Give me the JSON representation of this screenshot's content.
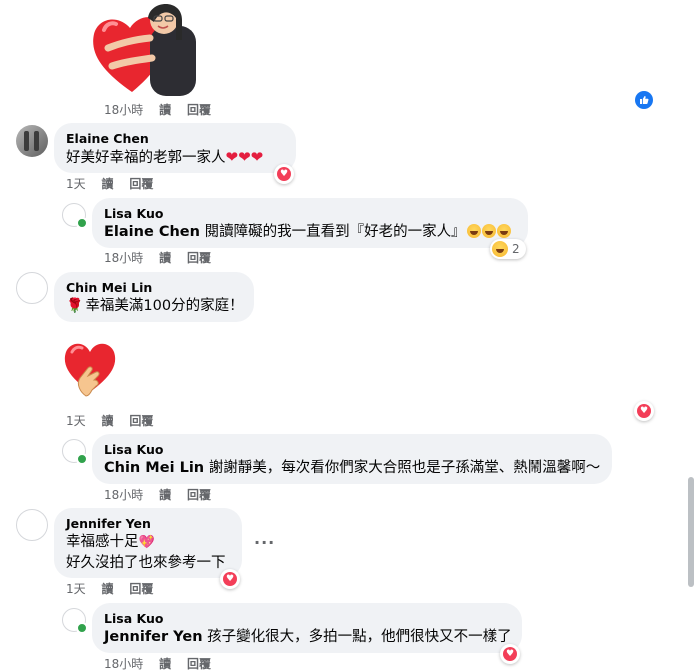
{
  "actions": {
    "read": "讀",
    "reply": "回覆"
  },
  "comments": [
    {
      "name": "",
      "time": "18小時"
    },
    {
      "name": "Elaine Chen",
      "text": "好美好幸福的老郭一家人",
      "time": "1天"
    },
    {
      "name": "Lisa Kuo",
      "tag": "Elaine Chen",
      "text": " 閱讀障礙的我一直看到『好老的一家人』",
      "time": "18小時",
      "reaction_count": "2"
    },
    {
      "name": "Chin Mei Lin",
      "text": "幸福美滿100分的家庭！",
      "time": "1天"
    },
    {
      "name": "Lisa Kuo",
      "tag": "Chin Mei Lin",
      "text": " 謝謝靜美，每次看你們家大合照也是子孫滿堂、熱鬧溫馨啊～",
      "time": "18小時"
    },
    {
      "name": "Jennifer Yen",
      "line1": "幸福感十足",
      "line2": "好久沒拍了也來參考一下",
      "time": "1天"
    },
    {
      "name": "Lisa Kuo",
      "tag": "Jennifer Yen",
      "text": " 孩子變化很大，多拍一點，他們很快又不一樣了",
      "time": "18小時"
    }
  ],
  "icons": {
    "like": "like-icon",
    "love": "heart-icon",
    "haha": "laughing-emoji-icon",
    "more": "more-options-icon"
  },
  "colors": {
    "bubble": "#f0f2f5",
    "love": "#f33e58",
    "like": "#1877f2",
    "meta": "#65676b",
    "online": "#31a24c"
  }
}
